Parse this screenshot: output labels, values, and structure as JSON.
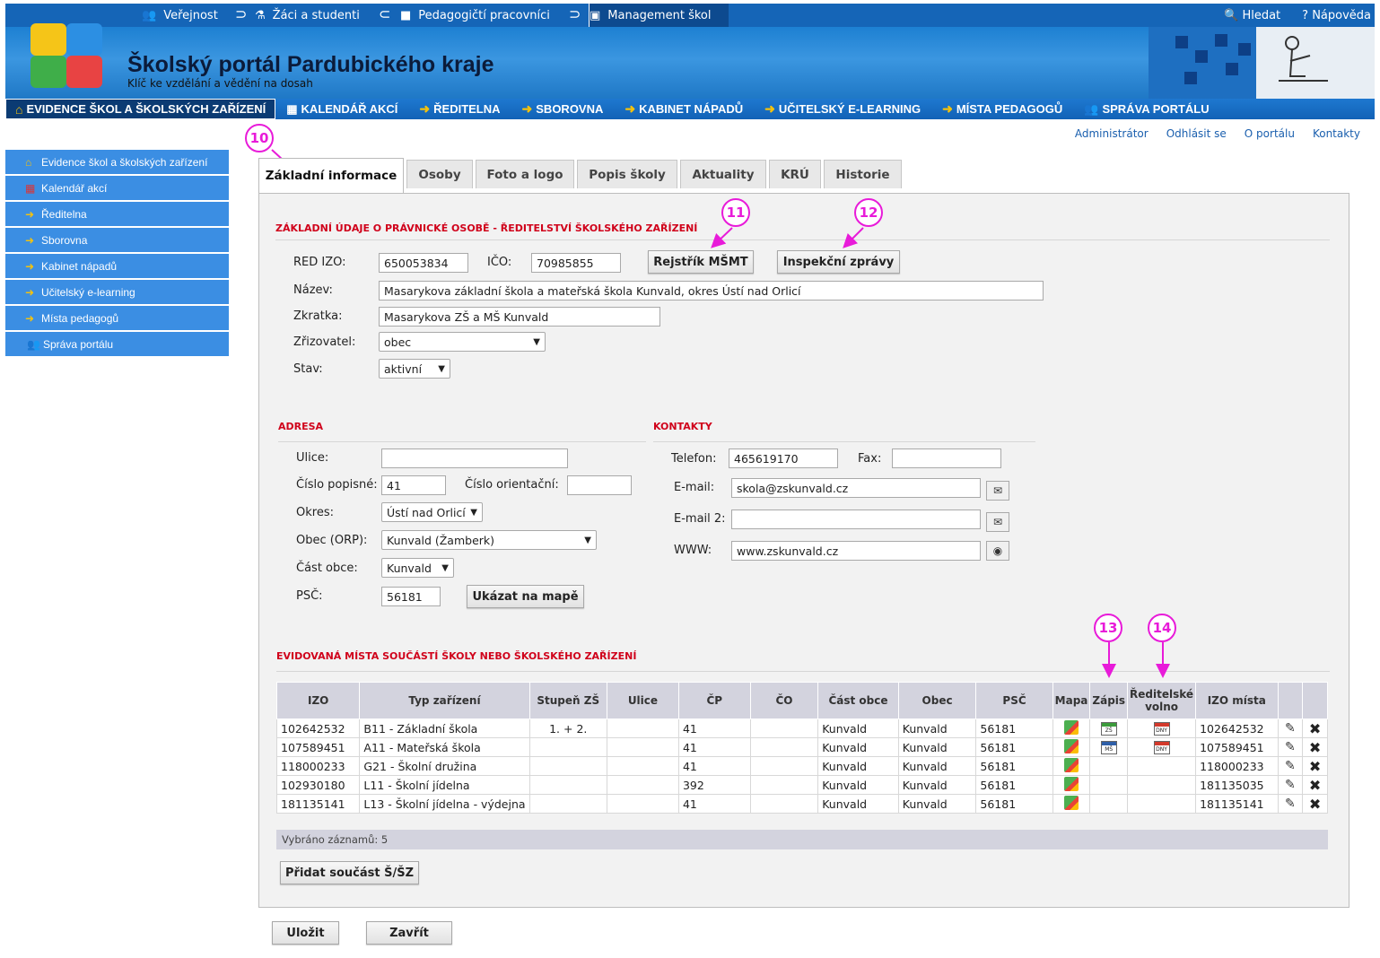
{
  "top": {
    "items": [
      {
        "label": "Veřejnost",
        "icon": "people-icon"
      },
      {
        "label": "Žáci a studenti",
        "icon": "student-icon"
      },
      {
        "label": "Pedagogičtí pracovníci",
        "icon": "teacher-icon"
      },
      {
        "label": "Management škol",
        "icon": "manager-icon"
      }
    ],
    "search": "Hledat",
    "help": "Nápověda"
  },
  "banner": {
    "title": "Školský portál Pardubického kraje",
    "subtitle": "Klíč ke vzdělání a vědění na dosah"
  },
  "nav": [
    "EVIDENCE ŠKOL A ŠKOLSKÝCH ZAŘÍZENÍ",
    "KALENDÁŘ AKCÍ",
    "ŘEDITELNA",
    "SBOROVNA",
    "KABINET NÁPADŮ",
    "UČITELSKÝ E-LEARNING",
    "MÍSTA PEDAGOGŮ",
    "SPRÁVA PORTÁLU"
  ],
  "userlinks": [
    "Administrátor",
    "Odhlásit se",
    "O portálu",
    "Kontakty"
  ],
  "sidebar": [
    "Evidence škol a školských zařízení",
    "Kalendář akcí",
    "Ředitelna",
    "Sborovna",
    "Kabinet nápadů",
    "Učitelský e-learning",
    "Místa pedagogů",
    "Správa portálu"
  ],
  "tabs": [
    "Základní informace",
    "Osoby",
    "Foto a logo",
    "Popis školy",
    "Aktuality",
    "KRÚ",
    "Historie"
  ],
  "basic": {
    "section": "ZÁKLADNÍ ÚDAJE O PRÁVNICKÉ OSOBĚ - ŘEDITELSTVÍ ŠKOLSKÉHO ZAŘÍZENÍ",
    "red_izo_label": "RED IZO:",
    "red_izo": "650053834",
    "ico_label": "IČO:",
    "ico": "70985855",
    "rejstrik": "Rejstřík MŠMT",
    "inspekce": "Inspekční zprávy",
    "nazev_label": "Název:",
    "nazev": "Masarykova základní škola a mateřská škola Kunvald, okres Ústí nad Orlicí",
    "zkratka_label": "Zkratka:",
    "zkratka": "Masarykova ZŠ a MŠ Kunvald",
    "zrizovatel_label": "Zřizovatel:",
    "zrizovatel": "obec",
    "stav_label": "Stav:",
    "stav": "aktivní"
  },
  "adresa": {
    "section": "ADRESA",
    "ulice_label": "Ulice:",
    "ulice": "",
    "cp_label": "Číslo popisné:",
    "cp": "41",
    "co_label": "Číslo orientační:",
    "co": "",
    "okres_label": "Okres:",
    "okres": "Ústí nad Orlicí",
    "obec_label": "Obec (ORP):",
    "obec": "Kunvald (Žamberk)",
    "cast_label": "Část obce:",
    "cast": "Kunvald",
    "psc_label": "PSČ:",
    "psc": "56181",
    "mapa": "Ukázat na mapě"
  },
  "kontakty": {
    "section": "KONTAKTY",
    "tel_label": "Telefon:",
    "tel": "465619170",
    "fax_label": "Fax:",
    "fax": "",
    "email_label": "E-mail:",
    "email": "skola@zskunvald.cz",
    "email2_label": "E-mail 2:",
    "email2": "",
    "www_label": "WWW:",
    "www": "www.zskunvald.cz"
  },
  "mista": {
    "section": "EVIDOVANÁ MÍSTA SOUČÁSTÍ ŠKOLY NEBO ŠKOLSKÉHO ZAŘÍZENÍ",
    "headers": [
      "IZO",
      "Typ zařízení",
      "Stupeň ZŠ",
      "Ulice",
      "ČP",
      "ČO",
      "Část obce",
      "Obec",
      "PSČ",
      "Mapa",
      "Zápis",
      "Ředitelské volno",
      "IZO místa"
    ],
    "rows": [
      {
        "izo": "102642532",
        "typ": "B11 - Základní škola",
        "stupen": "1. + 2.",
        "ulice": "",
        "cp": "41",
        "co": "",
        "cast": "Kunvald",
        "obec": "Kunvald",
        "psc": "56181",
        "zapis": "ZŠ",
        "volno": "DNY",
        "izo_mista": "102642532"
      },
      {
        "izo": "107589451",
        "typ": "A11 - Mateřská škola",
        "stupen": "",
        "ulice": "",
        "cp": "41",
        "co": "",
        "cast": "Kunvald",
        "obec": "Kunvald",
        "psc": "56181",
        "zapis": "MŠ",
        "volno": "DNY",
        "izo_mista": "107589451"
      },
      {
        "izo": "118000233",
        "typ": "G21 - Školní družina",
        "stupen": "",
        "ulice": "",
        "cp": "41",
        "co": "",
        "cast": "Kunvald",
        "obec": "Kunvald",
        "psc": "56181",
        "zapis": "",
        "volno": "",
        "izo_mista": "118000233"
      },
      {
        "izo": "102930180",
        "typ": "L11 - Školní jídelna",
        "stupen": "",
        "ulice": "",
        "cp": "392",
        "co": "",
        "cast": "Kunvald",
        "obec": "Kunvald",
        "psc": "56181",
        "zapis": "",
        "volno": "",
        "izo_mista": "181135035"
      },
      {
        "izo": "181135141",
        "typ": "L13 - Školní jídelna - výdejna",
        "stupen": "",
        "ulice": "",
        "cp": "41",
        "co": "",
        "cast": "Kunvald",
        "obec": "Kunvald",
        "psc": "56181",
        "zapis": "",
        "volno": "",
        "izo_mista": "181135141"
      }
    ],
    "count": "Vybráno záznamů: 5",
    "add": "Přidat součást Š/ŠZ"
  },
  "footer": {
    "save": "Uložit",
    "close": "Zavřít"
  },
  "annotations": [
    "10",
    "11",
    "12",
    "13",
    "14"
  ],
  "colors": {
    "accent": "#1565b7",
    "section": "#d0021b",
    "annotation": "#e81bd9"
  }
}
